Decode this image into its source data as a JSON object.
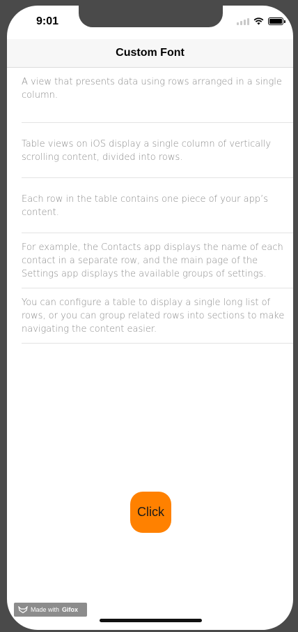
{
  "status": {
    "time": "9:01",
    "icons": [
      "signal-icon",
      "wifi-icon",
      "battery-icon"
    ]
  },
  "nav": {
    "title": "Custom Font"
  },
  "table": {
    "rows": [
      "A view that presents data using rows arranged in a single column.",
      "Table views on iOS display a single column of vertically scrolling content, divided into rows.",
      "Each row in the table contains one piece of your app’s content.",
      "For example, the Contacts app displays the name of each contact in a separate row, and the main page of the Settings app displays the available groups of settings.",
      "You can configure a table to display a single long list of rows, or you can group related rows into sections to make navigating the content easier."
    ]
  },
  "button": {
    "label": "Click",
    "color": "#ff8100"
  },
  "watermark": {
    "prefix": "Made with",
    "brand": "Gifox",
    "icon": "fox-icon"
  }
}
